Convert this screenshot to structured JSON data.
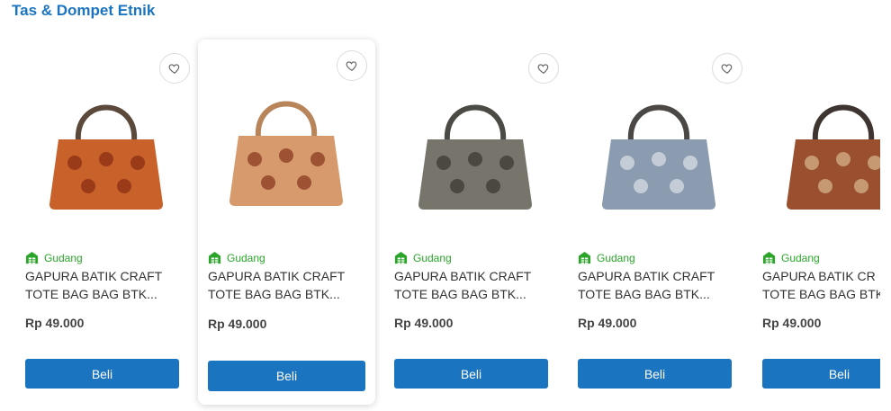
{
  "section": {
    "title": "Tas & Dompet Etnik"
  },
  "products": [
    {
      "store": "Gudang",
      "name_line1": "GAPURA BATIK CRAFT",
      "name_line2": "TOTE BAG BAG BTK...",
      "price": "Rp 49.000",
      "buy_label": "Beli",
      "icon": "heart-icon",
      "handle_color": "#5b4a3c",
      "bag_color": "#c9612a",
      "pattern_color": "#8a2d14"
    },
    {
      "store": "Gudang",
      "name_line1": "GAPURA BATIK CRAFT",
      "name_line2": "TOTE BAG BAG BTK...",
      "price": "Rp 49.000",
      "buy_label": "Beli",
      "icon": "heart-icon",
      "handle_color": "#b8845a",
      "bag_color": "#d79a6c",
      "pattern_color": "#8a3a22"
    },
    {
      "store": "Gudang",
      "name_line1": "GAPURA BATIK CRAFT",
      "name_line2": "TOTE BAG BAG BTK...",
      "price": "Rp 49.000",
      "buy_label": "Beli",
      "icon": "heart-icon",
      "handle_color": "#4c4a44",
      "bag_color": "#77746b",
      "pattern_color": "#3c3a33"
    },
    {
      "store": "Gudang",
      "name_line1": "GAPURA BATIK CRAFT",
      "name_line2": "TOTE BAG BAG BTK...",
      "price": "Rp 49.000",
      "buy_label": "Beli",
      "icon": "heart-icon",
      "handle_color": "#4a4744",
      "bag_color": "#8b9bb0",
      "pattern_color": "#d8dde6"
    },
    {
      "store": "Gudang",
      "name_line1": "GAPURA BATIK CR",
      "name_line2": "TOTE BAG BAG BTK",
      "price": "Rp 49.000",
      "buy_label": "Beli",
      "icon": "heart-icon",
      "handle_color": "#3e3530",
      "bag_color": "#9a4f2e",
      "pattern_color": "#d5b28a"
    }
  ],
  "colors": {
    "accent": "#1a74c0",
    "store_green": "#2aa52a"
  }
}
